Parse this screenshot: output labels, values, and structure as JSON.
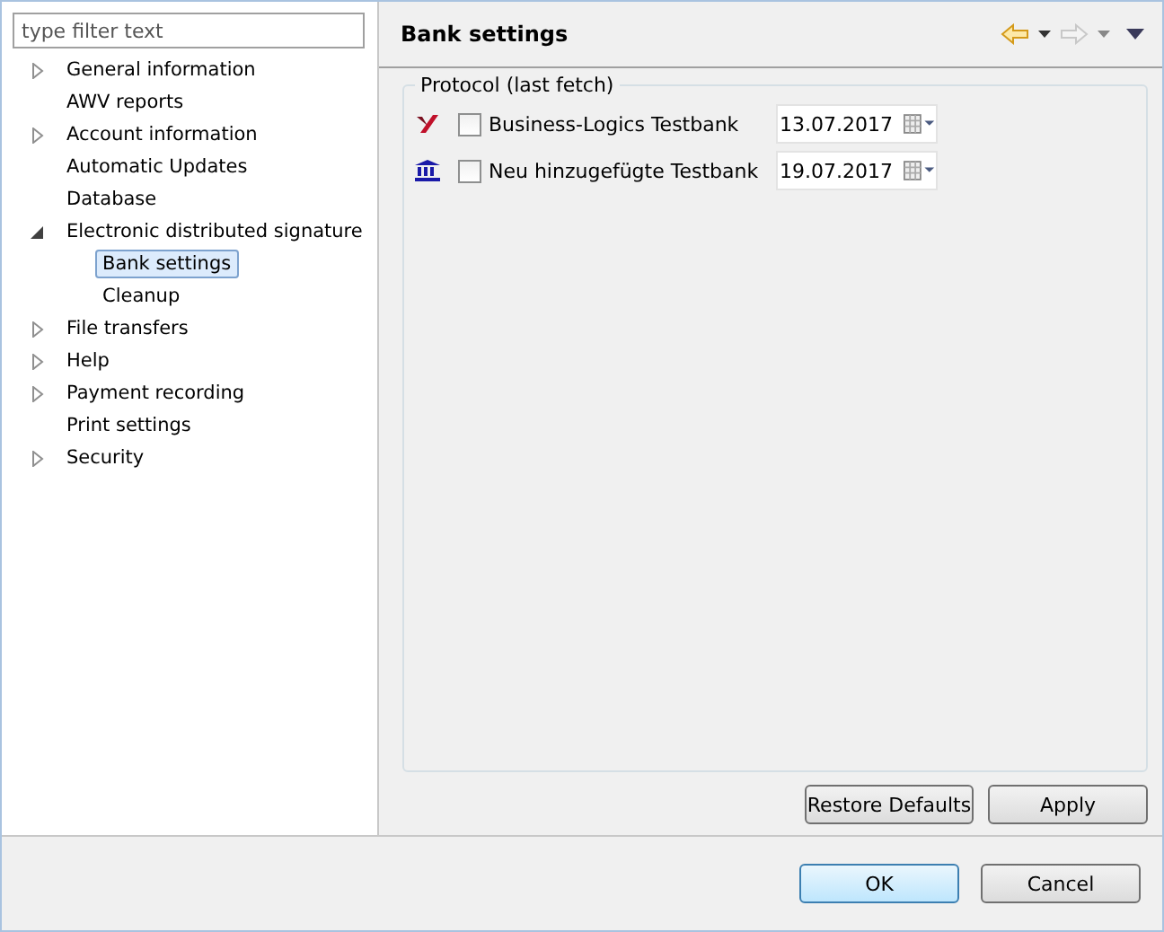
{
  "filter": {
    "placeholder": "type filter text"
  },
  "tree": [
    {
      "label": "General information",
      "expanded": false
    },
    {
      "label": "AWV reports"
    },
    {
      "label": "Account information",
      "expanded": false
    },
    {
      "label": "Automatic Updates"
    },
    {
      "label": "Database"
    },
    {
      "label": "Electronic distributed signature",
      "expanded": true,
      "children": [
        {
          "label": "Bank settings",
          "selected": true
        },
        {
          "label": "Cleanup",
          "selected": false
        }
      ]
    },
    {
      "label": "File transfers",
      "expanded": false
    },
    {
      "label": "Help",
      "expanded": false
    },
    {
      "label": "Payment recording",
      "expanded": false
    },
    {
      "label": "Print settings"
    },
    {
      "label": "Security",
      "expanded": false
    }
  ],
  "page": {
    "title": "Bank settings",
    "back_enabled": true,
    "forward_enabled": false
  },
  "group": {
    "title": "Protocol (last fetch)",
    "banks": [
      {
        "kind": "logo",
        "name": "Business-Logics Testbank",
        "checked": false,
        "date": "13.07.2017"
      },
      {
        "kind": "building",
        "name": "Neu hinzugefügte Testbank",
        "checked": false,
        "date": "19.07.2017"
      }
    ]
  },
  "page_buttons": [
    "Restore Defaults",
    "Apply"
  ],
  "dialog_buttons": [
    {
      "label": "OK",
      "default": true
    },
    {
      "label": "Cancel",
      "default": false
    }
  ]
}
